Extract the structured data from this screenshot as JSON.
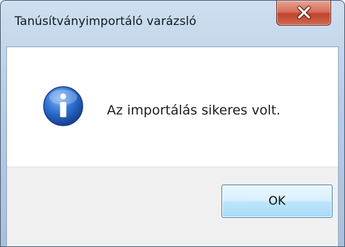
{
  "window": {
    "title": "Tanúsítványimportáló varázsló"
  },
  "titlebar": {
    "close_icon": "close-icon"
  },
  "message": {
    "icon": "info-icon",
    "text": "Az importálás sikeres volt."
  },
  "buttons": {
    "ok_label": "OK"
  },
  "colors": {
    "close_button": "#c7462f",
    "info_icon": "#2a66c6",
    "ok_button_border": "#3c7fb1"
  }
}
